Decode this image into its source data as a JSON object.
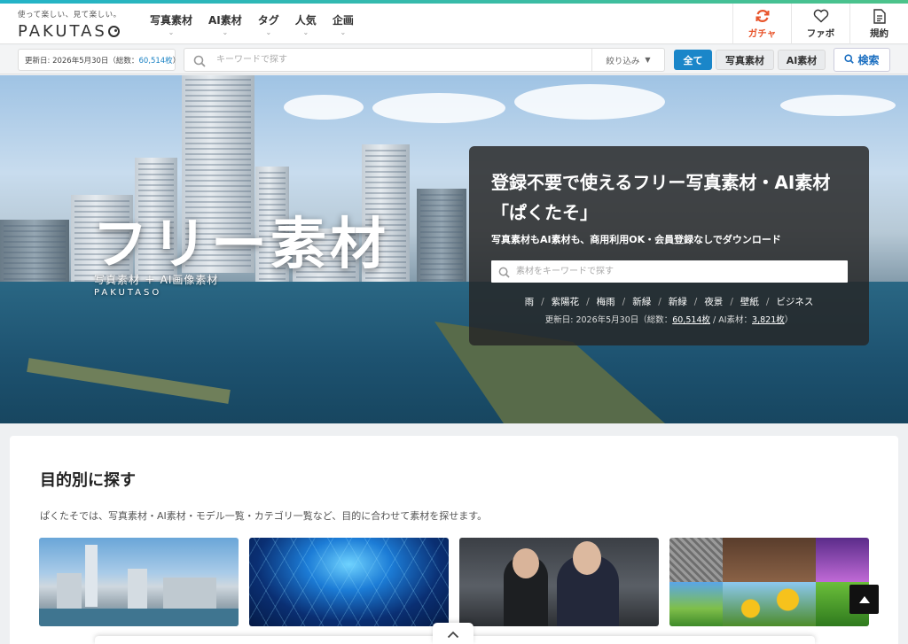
{
  "brand": {
    "tagline": "使って楽しい、見て楽しい。",
    "name": "PAKUTAS"
  },
  "nav": [
    {
      "label": "写真素材"
    },
    {
      "label": "AI素材"
    },
    {
      "label": "タグ"
    },
    {
      "label": "人気"
    },
    {
      "label": "企画"
    }
  ],
  "header_actions": {
    "gacha": "ガチャ",
    "favorites": "ファボ",
    "terms": "規約"
  },
  "searchbar": {
    "updated_prefix": "更新日: 2026年5月30日（総数：",
    "updated_count": "60,514枚",
    "updated_suffix": "）",
    "placeholder": "キーワードで探す",
    "filter_label": "絞り込み",
    "pill_all": "全て",
    "pill_photo": "写真素材",
    "pill_ai": "AI素材",
    "search_button": "検索"
  },
  "hero": {
    "title": "フリー素材",
    "subtitle": "写真素材 ＋ AI画像素材",
    "brand": "PAKUTASO",
    "panel": {
      "title": "登録不要で使えるフリー写真素材・AI素材「ぱくたそ」",
      "lead": "写真素材もAI素材も、商用利用OK・会員登録なしでダウンロード",
      "placeholder": "素材をキーワードで探す",
      "tags": [
        "雨",
        "紫陽花",
        "梅雨",
        "新緑",
        "新緑",
        "夜景",
        "壁紙",
        "ビジネス"
      ],
      "meta_prefix": "更新日: 2026年5月30日（総数：",
      "meta_total": "60,514枚",
      "meta_mid": " / AI素材：",
      "meta_ai": "3,821枚",
      "meta_suffix": "）"
    }
  },
  "section": {
    "title": "目的別に探す",
    "description": "ぱくたそでは、写真素材・AI素材・モデル一覧・カテゴリ一覧など、目的に合わせて素材を探せます。"
  },
  "colors": {
    "accent": "#1a86c9",
    "gacha": "#e8552c",
    "topline_start": "#23b3c8",
    "topline_end": "#4cc38a"
  }
}
